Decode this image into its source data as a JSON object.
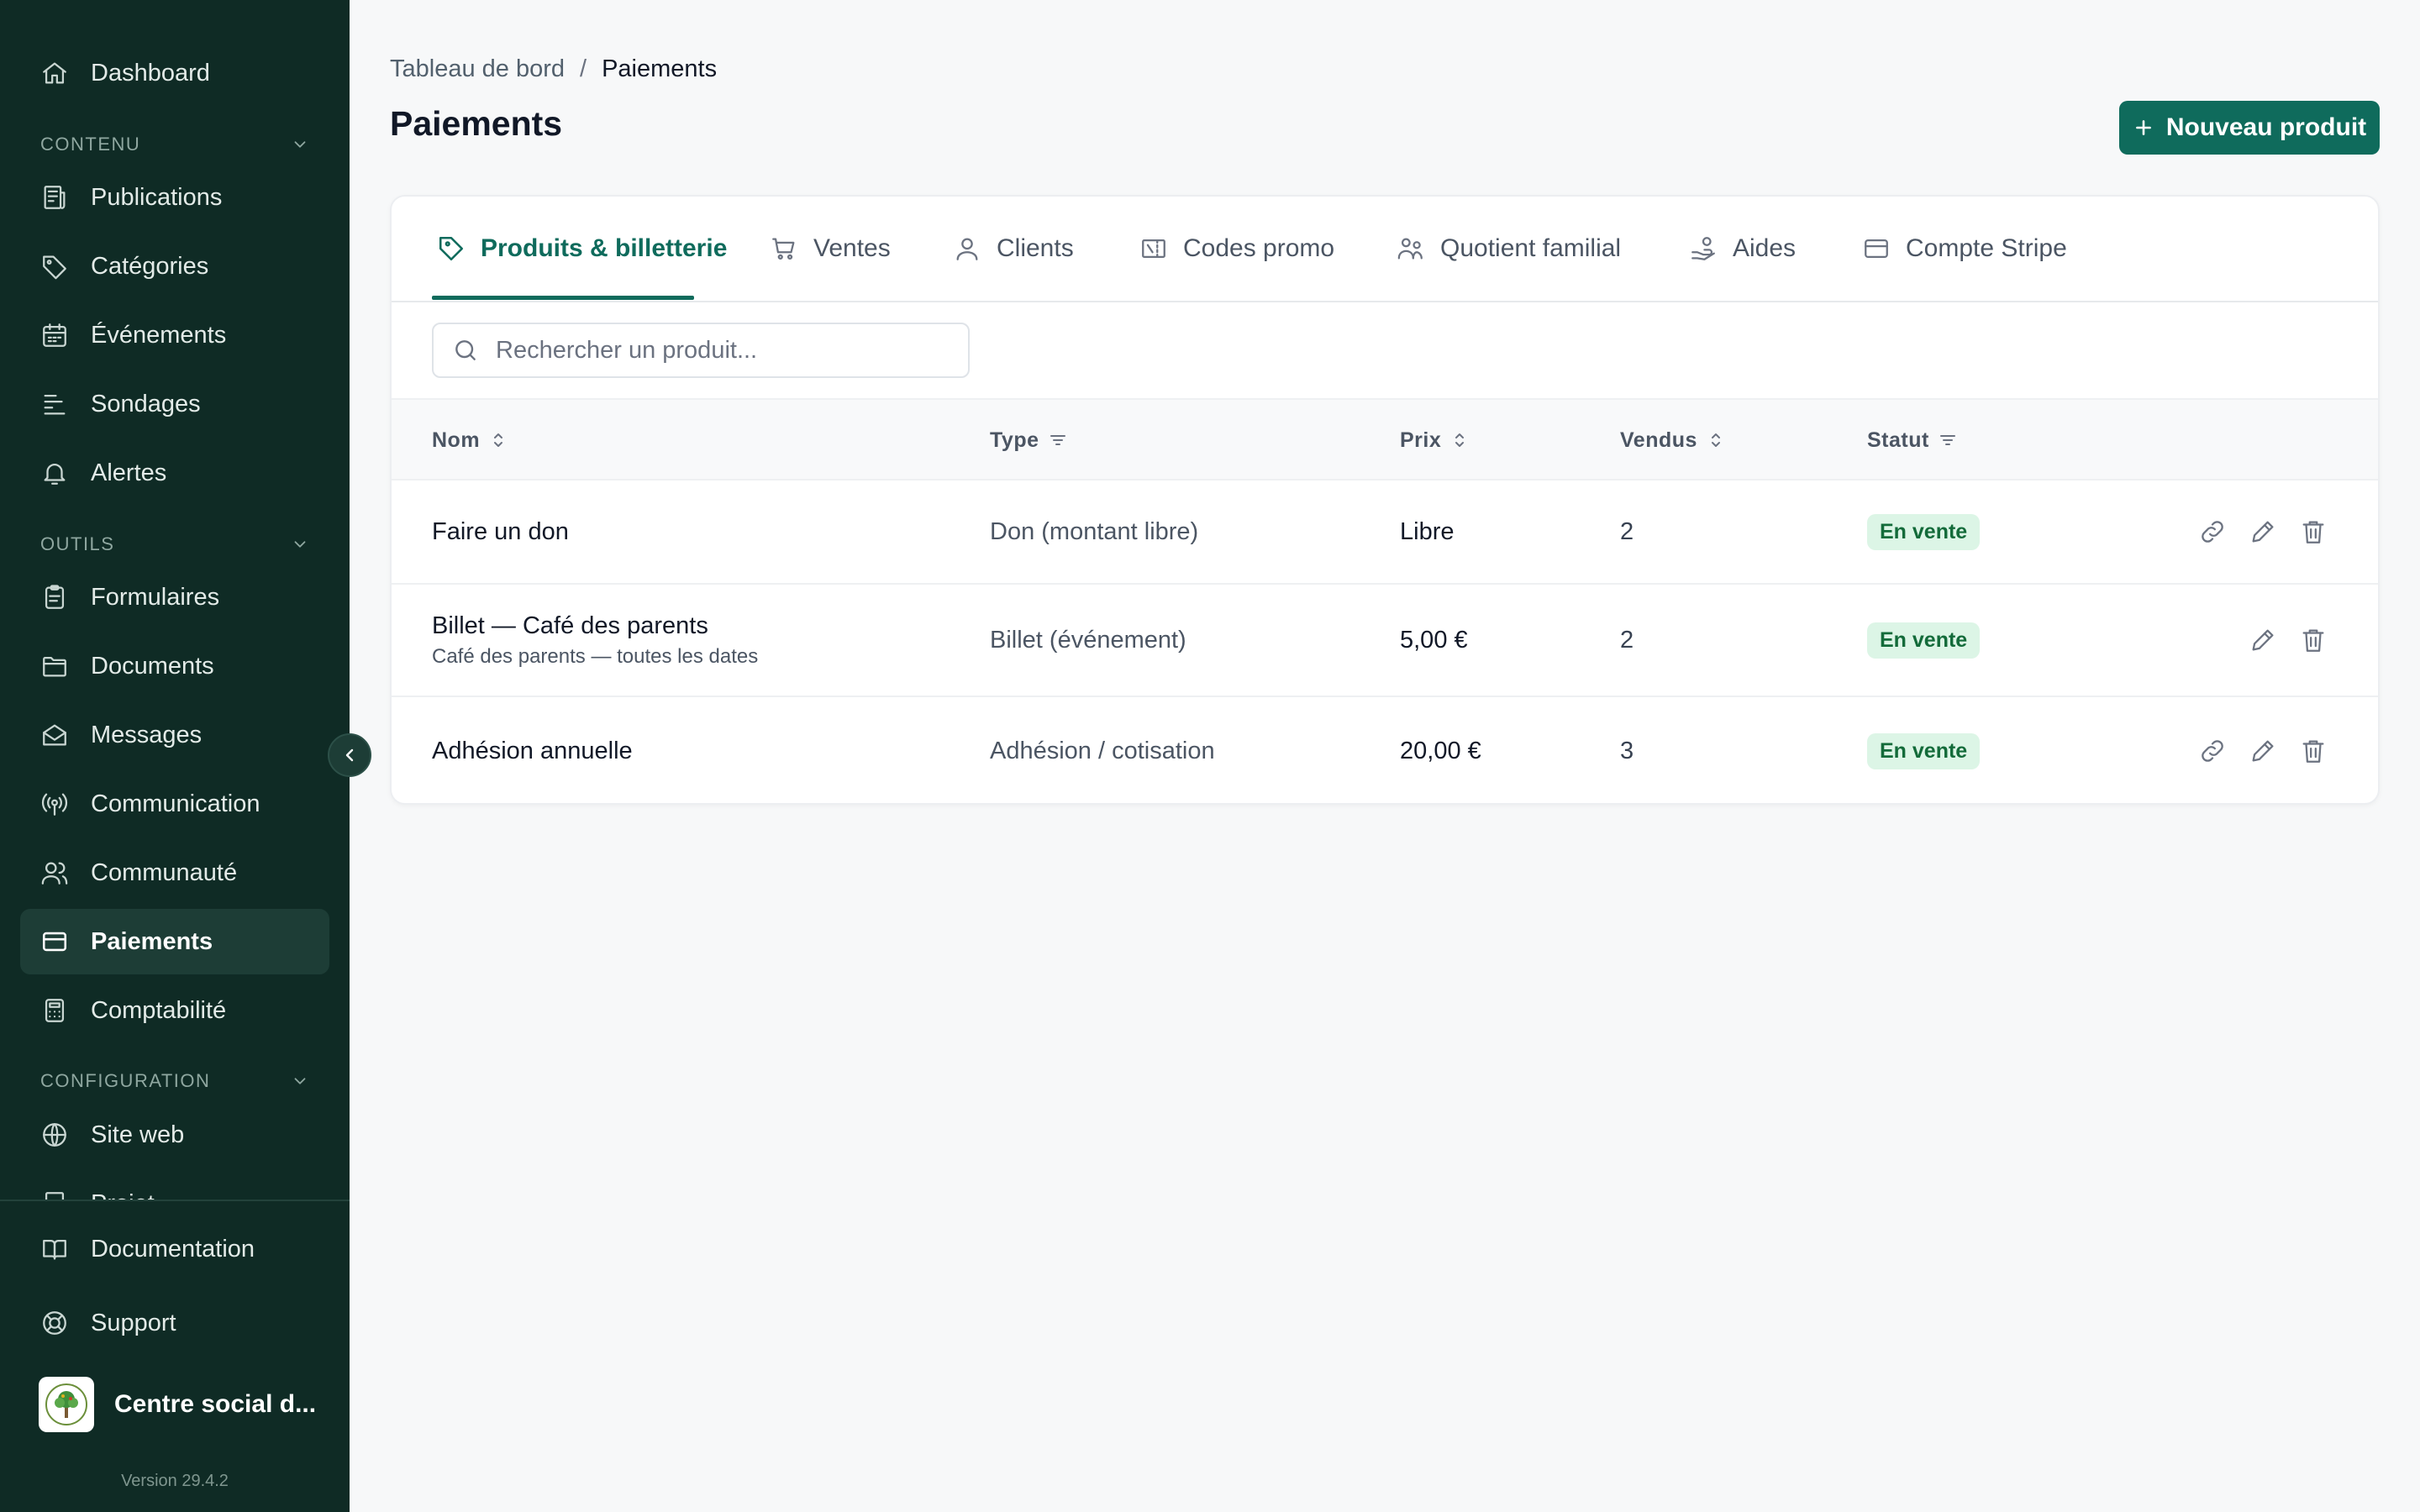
{
  "sidebar": {
    "top_item": {
      "label": "Dashboard",
      "icon": "home-icon"
    },
    "sections": [
      {
        "title": "CONTENU",
        "items": [
          {
            "label": "Publications",
            "icon": "newspaper-icon"
          },
          {
            "label": "Catégories",
            "icon": "tag-icon"
          },
          {
            "label": "Événements",
            "icon": "calendar-icon"
          },
          {
            "label": "Sondages",
            "icon": "poll-icon"
          },
          {
            "label": "Alertes",
            "icon": "bell-icon"
          }
        ]
      },
      {
        "title": "OUTILS",
        "items": [
          {
            "label": "Formulaires",
            "icon": "clipboard-icon"
          },
          {
            "label": "Documents",
            "icon": "folder-icon"
          },
          {
            "label": "Messages",
            "icon": "envelope-icon"
          },
          {
            "label": "Communication",
            "icon": "broadcast-icon"
          },
          {
            "label": "Communauté",
            "icon": "users-icon"
          },
          {
            "label": "Paiements",
            "icon": "credit-card-icon",
            "active": true
          },
          {
            "label": "Comptabilité",
            "icon": "calculator-icon"
          }
        ]
      },
      {
        "title": "CONFIGURATION",
        "items": [
          {
            "label": "Site web",
            "icon": "globe-icon"
          },
          {
            "label": "Projet",
            "icon": "file-icon"
          }
        ]
      }
    ],
    "footer_items": [
      {
        "label": "Documentation",
        "icon": "book-icon"
      },
      {
        "label": "Support",
        "icon": "lifebuoy-icon"
      }
    ],
    "org_name": "Centre social d...",
    "version": "Version 29.4.2"
  },
  "breadcrumb": {
    "parent": "Tableau de bord",
    "separator": "/",
    "current": "Paiements"
  },
  "page_title": "Paiements",
  "new_product_button": "Nouveau produit",
  "tabs": [
    {
      "label": "Produits & billetterie",
      "icon": "tag-icon",
      "active": true
    },
    {
      "label": "Ventes",
      "icon": "cart-icon"
    },
    {
      "label": "Clients",
      "icon": "user-icon"
    },
    {
      "label": "Codes promo",
      "icon": "ticket-icon"
    },
    {
      "label": "Quotient familial",
      "icon": "family-icon"
    },
    {
      "label": "Aides",
      "icon": "hand-coins-icon"
    },
    {
      "label": "Compte Stripe",
      "icon": "credit-card-icon"
    }
  ],
  "search": {
    "placeholder": "Rechercher un produit..."
  },
  "table": {
    "columns": [
      {
        "label": "Nom",
        "control": "sort"
      },
      {
        "label": "Type",
        "control": "filter"
      },
      {
        "label": "Prix",
        "control": "sort"
      },
      {
        "label": "Vendus",
        "control": "sort"
      },
      {
        "label": "Statut",
        "control": "filter"
      }
    ],
    "rows": [
      {
        "name": "Faire un don",
        "subtitle": "",
        "type": "Don (montant libre)",
        "price": "Libre",
        "sold": "2",
        "status": "En vente",
        "has_link": true
      },
      {
        "name": "Billet — Café des parents",
        "subtitle": "Café des parents — toutes les dates",
        "type": "Billet (événement)",
        "price": "5,00 €",
        "sold": "2",
        "status": "En vente",
        "has_link": false
      },
      {
        "name": "Adhésion annuelle",
        "subtitle": "",
        "type": "Adhésion / cotisation",
        "price": "20,00 €",
        "sold": "3",
        "status": "En vente",
        "has_link": true
      }
    ]
  },
  "colors": {
    "sidebar_bg": "#0f2b25",
    "accent": "#0f6b5c",
    "badge_bg": "#dcf5e6",
    "badge_text": "#136b3a"
  }
}
